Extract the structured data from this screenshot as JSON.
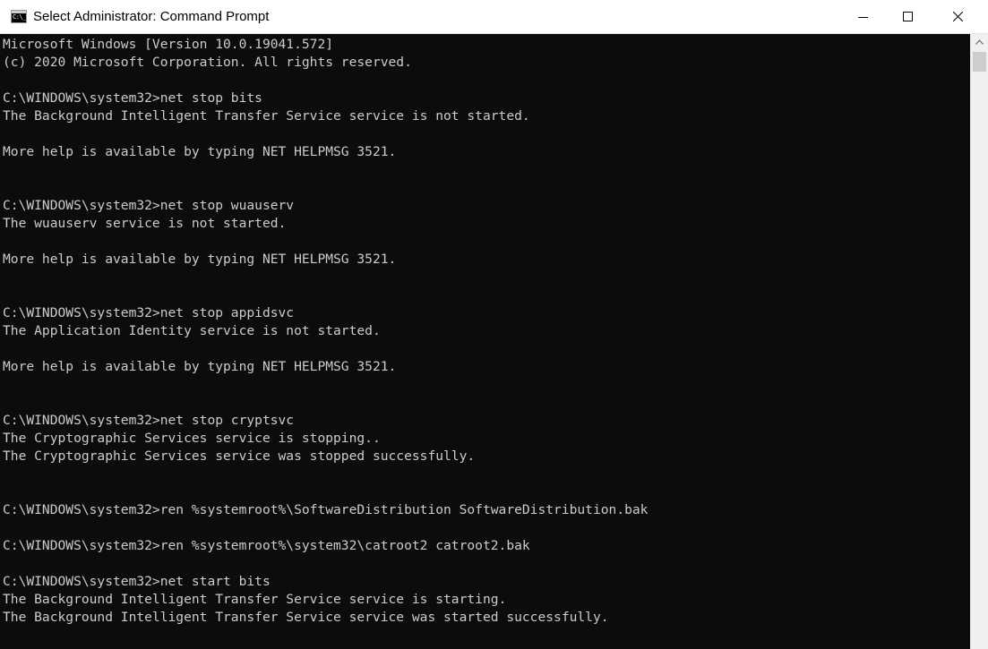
{
  "window": {
    "title": "Select Administrator: Command Prompt",
    "icon": "cmd-icon",
    "icon_glyph": "C:\\_"
  },
  "controls": {
    "minimize_icon": "minimize-icon",
    "maximize_icon": "maximize-icon",
    "close_icon": "close-icon"
  },
  "console": {
    "lines": [
      "Microsoft Windows [Version 10.0.19041.572]",
      "(c) 2020 Microsoft Corporation. All rights reserved.",
      "",
      "C:\\WINDOWS\\system32>net stop bits",
      "The Background Intelligent Transfer Service service is not started.",
      "",
      "More help is available by typing NET HELPMSG 3521.",
      "",
      "",
      "C:\\WINDOWS\\system32>net stop wuauserv",
      "The wuauserv service is not started.",
      "",
      "More help is available by typing NET HELPMSG 3521.",
      "",
      "",
      "C:\\WINDOWS\\system32>net stop appidsvc",
      "The Application Identity service is not started.",
      "",
      "More help is available by typing NET HELPMSG 3521.",
      "",
      "",
      "C:\\WINDOWS\\system32>net stop cryptsvc",
      "The Cryptographic Services service is stopping..",
      "The Cryptographic Services service was stopped successfully.",
      "",
      "",
      "C:\\WINDOWS\\system32>ren %systemroot%\\SoftwareDistribution SoftwareDistribution.bak",
      "",
      "C:\\WINDOWS\\system32>ren %systemroot%\\system32\\catroot2 catroot2.bak",
      "",
      "C:\\WINDOWS\\system32>net start bits",
      "The Background Intelligent Transfer Service service is starting.",
      "The Background Intelligent Transfer Service service was started successfully."
    ]
  },
  "colors": {
    "console_bg": "#0c0c0c",
    "console_fg": "#cccccc",
    "titlebar_bg": "#ffffff"
  }
}
